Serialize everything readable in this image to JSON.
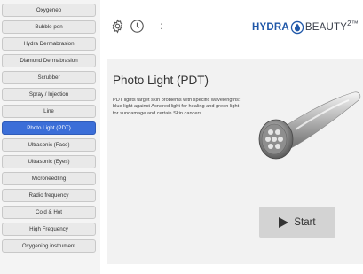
{
  "sidebar": {
    "items": [
      {
        "label": "Oxygeneo",
        "active": false
      },
      {
        "label": "Bubble pen",
        "active": false
      },
      {
        "label": "Hydra Dermabrasion",
        "active": false
      },
      {
        "label": "Diamond Dermabrasion",
        "active": false
      },
      {
        "label": "Scrubber",
        "active": false
      },
      {
        "label": "Spray / Injection",
        "active": false
      },
      {
        "label": "Line",
        "active": false
      },
      {
        "label": "Photo Light (PDT)",
        "active": true
      },
      {
        "label": "Ultrasonic (Face)",
        "active": false
      },
      {
        "label": "Ultrasonic (Eyes)",
        "active": false
      },
      {
        "label": "Microneedling",
        "active": false
      },
      {
        "label": "Radio frequency",
        "active": false
      },
      {
        "label": "Cold & Hot",
        "active": false
      },
      {
        "label": "High Frequency",
        "active": false
      },
      {
        "label": "Oxygening instrument",
        "active": false
      }
    ]
  },
  "topbar": {
    "icons": [
      "gear-icon",
      "clock-icon"
    ],
    "separator": ":"
  },
  "logo": {
    "part1": "HYDRA",
    "part2": "BEAUTY",
    "sup": "2™"
  },
  "panel": {
    "title": "Photo Light (PDT)",
    "description": "PDT lights target skin problems with specific wavelengths: blue light against Acnered light for healing and green light for sundamage and certain Skin cancers",
    "start_label": "Start"
  },
  "colors": {
    "active": "#3b6ed8",
    "logo_blue": "#1f57a8",
    "button_bg": "#d3d3d3"
  }
}
